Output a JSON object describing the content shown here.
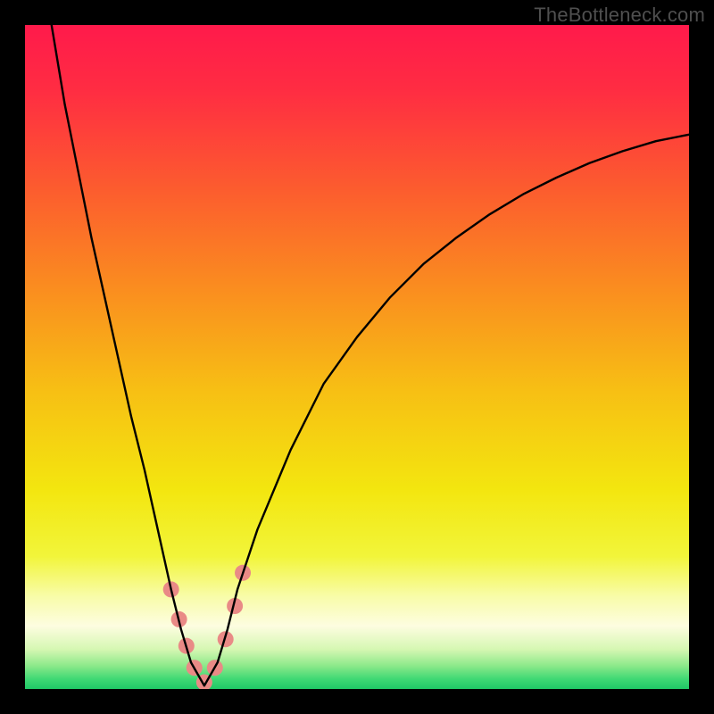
{
  "watermark": {
    "text": "TheBottleneck.com"
  },
  "gradient": {
    "stops": [
      {
        "offset": 0.0,
        "color": "#ff1a4b"
      },
      {
        "offset": 0.1,
        "color": "#ff2d42"
      },
      {
        "offset": 0.25,
        "color": "#fc5d2e"
      },
      {
        "offset": 0.4,
        "color": "#fa8e1f"
      },
      {
        "offset": 0.55,
        "color": "#f7bf14"
      },
      {
        "offset": 0.7,
        "color": "#f3e60f"
      },
      {
        "offset": 0.8,
        "color": "#f2f53a"
      },
      {
        "offset": 0.86,
        "color": "#f8fca8"
      },
      {
        "offset": 0.905,
        "color": "#fdfde0"
      },
      {
        "offset": 0.94,
        "color": "#d6f7b3"
      },
      {
        "offset": 0.965,
        "color": "#8ce98a"
      },
      {
        "offset": 0.985,
        "color": "#3fd874"
      },
      {
        "offset": 1.0,
        "color": "#1fc866"
      }
    ]
  },
  "chart_data": {
    "type": "line",
    "title": "",
    "xlabel": "",
    "ylabel": "",
    "xlim": [
      0,
      100
    ],
    "ylim": [
      0,
      100
    ],
    "grid": false,
    "note": "V-shaped bottleneck curve. x is a normalized component-balance axis (0–100), y is bottleneck percentage (0 = none, 100 = severe). Minimum near x≈27. Values estimated from plotted curve; underlying formula not shown.",
    "series": [
      {
        "name": "bottleneck-curve",
        "color": "#000000",
        "x": [
          4,
          6,
          8,
          10,
          12,
          14,
          16,
          18,
          20,
          22,
          23.5,
          25,
          27,
          29,
          30.5,
          32,
          35,
          40,
          45,
          50,
          55,
          60,
          65,
          70,
          75,
          80,
          85,
          90,
          95,
          100
        ],
        "y": [
          100,
          88,
          78,
          68,
          59,
          50,
          41,
          33,
          24,
          15,
          9,
          4,
          0.5,
          4,
          9,
          15,
          24,
          36,
          46,
          53,
          59,
          64,
          68,
          71.5,
          74.5,
          77,
          79.2,
          81,
          82.5,
          83.5
        ]
      }
    ],
    "markers": {
      "name": "highlight-dots",
      "color": "#e98a86",
      "radius_px": 9,
      "x": [
        22.0,
        23.2,
        24.3,
        25.5,
        27.0,
        28.6,
        30.2,
        31.6,
        32.8
      ],
      "y": [
        15.0,
        10.5,
        6.5,
        3.2,
        1.0,
        3.2,
        7.5,
        12.5,
        17.5
      ]
    }
  }
}
